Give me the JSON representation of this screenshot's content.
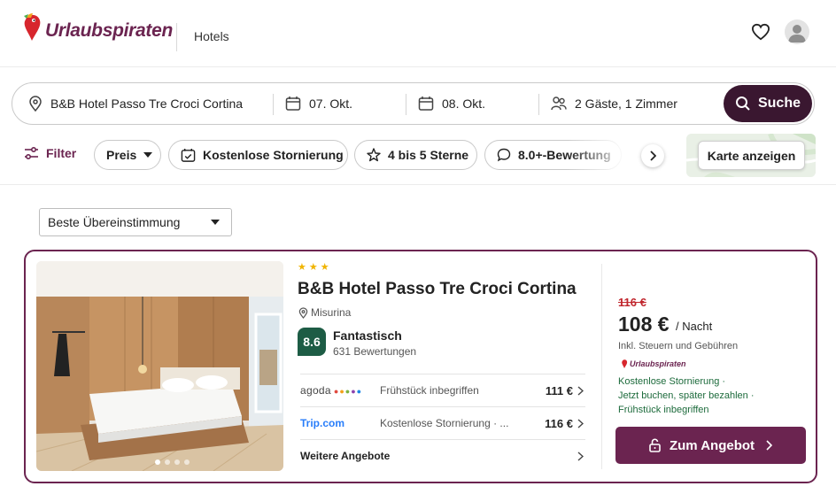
{
  "header": {
    "brand": "Urlaubspiraten",
    "section": "Hotels"
  },
  "search": {
    "destination": "B&B Hotel Passo Tre Croci Cortina",
    "checkin": "07. Okt.",
    "checkout": "08. Okt.",
    "guests": "2 Gäste, 1 Zimmer",
    "button": "Suche"
  },
  "filters": {
    "filter_label": "Filter",
    "chips": [
      "Preis",
      "Kostenlose Stornierung",
      "4 bis 5 Sterne",
      "8.0+-Bewertung"
    ],
    "map_button": "Karte anzeigen"
  },
  "sort": {
    "selected": "Beste Übereinstimmung"
  },
  "hotel": {
    "stars": 3,
    "name": "B&B Hotel Passo Tre Croci Cortina",
    "location": "Misurina",
    "rating": "8.6",
    "rating_word": "Fantastisch",
    "reviews": "631 Bewertungen",
    "photo_index": 1,
    "photo_count": 4,
    "offers": [
      {
        "partner": "agoda",
        "desc": "Frühstück inbegriffen",
        "price": "111 €"
      },
      {
        "partner": "Trip.com",
        "desc": "Kostenlose Stornierung · ...",
        "price": "116 €"
      }
    ],
    "more_offers": "Weitere Angebote",
    "old_price": "116 €",
    "price": "108 €",
    "price_unit": "/ Nacht",
    "tax_note": "Inkl. Steuern und Gebühren",
    "provider": "Urlaubspiraten",
    "perks": [
      "Kostenlose Stornierung ·",
      "Jetzt buchen, später bezahlen ·",
      "Frühstück inbegriffen"
    ],
    "cta": "Zum Angebot"
  },
  "colors": {
    "brand": "#6b2450",
    "search_button": "#3a1730",
    "rating_badge": "#1d5c45",
    "perk_text": "#1d6b3c",
    "old_price": "#c0262d"
  }
}
